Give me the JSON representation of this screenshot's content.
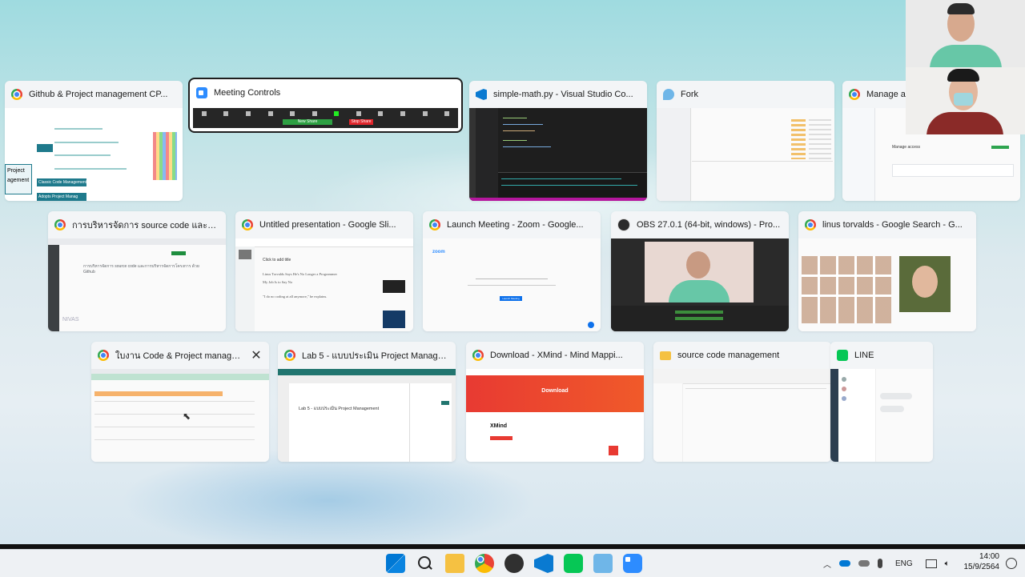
{
  "row1": [
    {
      "title": "Github & Project management CP...",
      "icon": "chrome-icon"
    },
    {
      "title": "Meeting Controls",
      "icon": "zoom-icon",
      "selected": true
    },
    {
      "title": "simple-math.py - Visual Studio Co...",
      "icon": "vscode-icon"
    },
    {
      "title": "Fork",
      "icon": "fork-icon"
    },
    {
      "title": "Manage ac",
      "icon": "chrome-icon"
    }
  ],
  "row2": [
    {
      "title": "การบริหารจัดการ source code และการ...",
      "icon": "chrome-icon"
    },
    {
      "title": "Untitled presentation - Google Sli...",
      "icon": "chrome-icon"
    },
    {
      "title": "Launch Meeting - Zoom - Google...",
      "icon": "chrome-icon"
    },
    {
      "title": "OBS 27.0.1 (64-bit, windows) - Pro...",
      "icon": "obs-icon"
    },
    {
      "title": "linus torvalds - Google Search - G...",
      "icon": "chrome-icon"
    }
  ],
  "row3": [
    {
      "title": "ใบงาน Code & Project manageme...",
      "icon": "chrome-icon",
      "close": "✕"
    },
    {
      "title": "Lab 5 - แบบประเมิน Project Manage...",
      "icon": "chrome-icon"
    },
    {
      "title": "Download - XMind - Mind Mappi...",
      "icon": "chrome-icon"
    },
    {
      "title": "source code management",
      "icon": "folder-icon"
    },
    {
      "title": "LINE",
      "icon": "line-icon"
    }
  ],
  "thumbs": {
    "mind_label1": "Project",
    "mind_label2": "agement",
    "mind_btn1": "Classic Code Management",
    "mind_btn2": "Adopts Project Manag",
    "meeting_stop": "Stop Share",
    "meeting_share": "New Share",
    "slides_line1": "Click to add title",
    "slides_line2": "Linus Torvalds Says He's No Longer a Programmer",
    "slides_line3": "My Job Is to Say No",
    "slides_line4": "\"I do no coding at all anymore,\" he explains.",
    "zoom_brand": "zoom",
    "zoom_btn": "Launch Meeting",
    "xmind_title": "Download",
    "xmind_brand": "XMind",
    "lab_title": "Lab 5 - แบบประเมิน Project Management",
    "thai_title": "การบริหารจัดการ source code และการบริหารจัดการโครงการ ด้วย Github",
    "manage_access": "Manage access",
    "watermark": "NIVAS"
  },
  "taskbar": {
    "apps": [
      "windows-start-icon",
      "search-icon",
      "file-explorer-icon",
      "chrome-icon",
      "obs-icon",
      "vscode-icon",
      "line-icon",
      "fork-icon",
      "zoom-icon"
    ],
    "lang": "ENG",
    "time": "14:00",
    "date": "15/9/2564"
  }
}
